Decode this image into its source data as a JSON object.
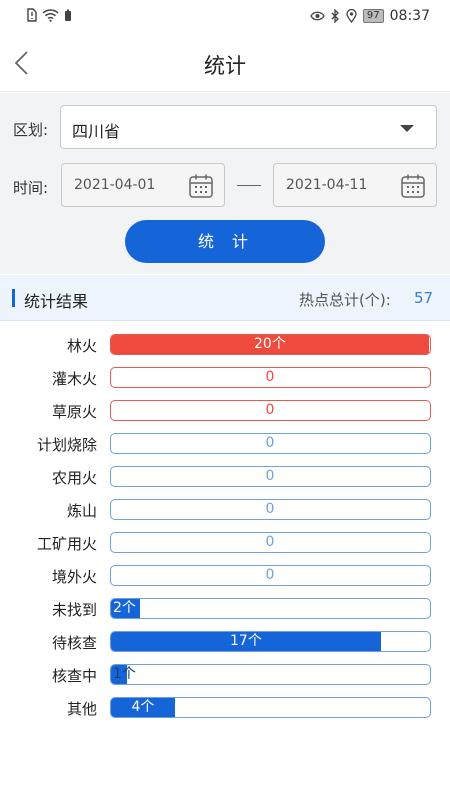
{
  "status": {
    "time": "08:37",
    "battery": "97",
    "left_icons": [
      "sim-alert-icon",
      "wifi-icon",
      "battery-small-icon"
    ],
    "right_icons": [
      "eye-icon",
      "bluetooth-icon",
      "location-icon"
    ]
  },
  "header": {
    "title": "统计",
    "back_icon": "chevron-left-icon"
  },
  "form": {
    "region_label": "区划:",
    "region_value": "四川省",
    "time_label": "时间:",
    "start_date": "2021-04-01",
    "end_date": "2021-04-11",
    "submit_label": "统计"
  },
  "result": {
    "title": "统计结果",
    "total_label": "热点总计(个):",
    "total_value": "57"
  },
  "colors": {
    "accent": "#1565d8",
    "danger": "#f04a3e",
    "danger_border": "#e25c53",
    "track_border": "#6da0dd",
    "zero_text": "#6aa1df"
  },
  "chart_data": {
    "type": "bar",
    "categories": [
      "林火",
      "灌木火",
      "草原火",
      "计划烧除",
      "农用火",
      "炼山",
      "工矿用火",
      "境外火",
      "未找到",
      "待核查",
      "核查中",
      "其他"
    ],
    "values": [
      20,
      0,
      0,
      0,
      0,
      0,
      0,
      0,
      2,
      17,
      1,
      4
    ],
    "value_labels": [
      "20个",
      "0",
      "0",
      "0",
      "0",
      "0",
      "0",
      "0",
      "2个",
      "17个",
      "1个",
      "4个"
    ],
    "fill_fraction": [
      1.0,
      0,
      0,
      0,
      0,
      0,
      0,
      0,
      0.09,
      0.85,
      0.05,
      0.2
    ],
    "style": [
      "red",
      "red",
      "red",
      "blue",
      "blue",
      "blue",
      "blue",
      "blue",
      "blue",
      "blue",
      "blue",
      "blue"
    ]
  }
}
